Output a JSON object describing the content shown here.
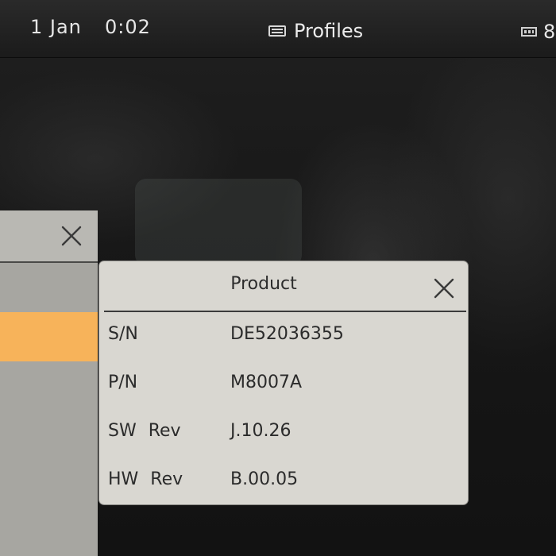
{
  "status_bar": {
    "date": "1 Jan",
    "time": "0:02",
    "profiles_icon": "profiles-icon",
    "profiles_label": "Profiles",
    "battery_icon": "battery-icon",
    "battery_text": "8"
  },
  "left_dialog": {
    "close_icon": "close-icon",
    "highlight_color": "#f7b35a"
  },
  "product_dialog": {
    "title": "Product",
    "close_icon": "close-icon",
    "rows": [
      {
        "label": "S/N",
        "value": "DE52036355"
      },
      {
        "label": "P/N",
        "value": "M8007A"
      },
      {
        "label": "SW Rev",
        "value": "J.10.26"
      },
      {
        "label": "HW Rev",
        "value": "B.00.05"
      }
    ]
  }
}
